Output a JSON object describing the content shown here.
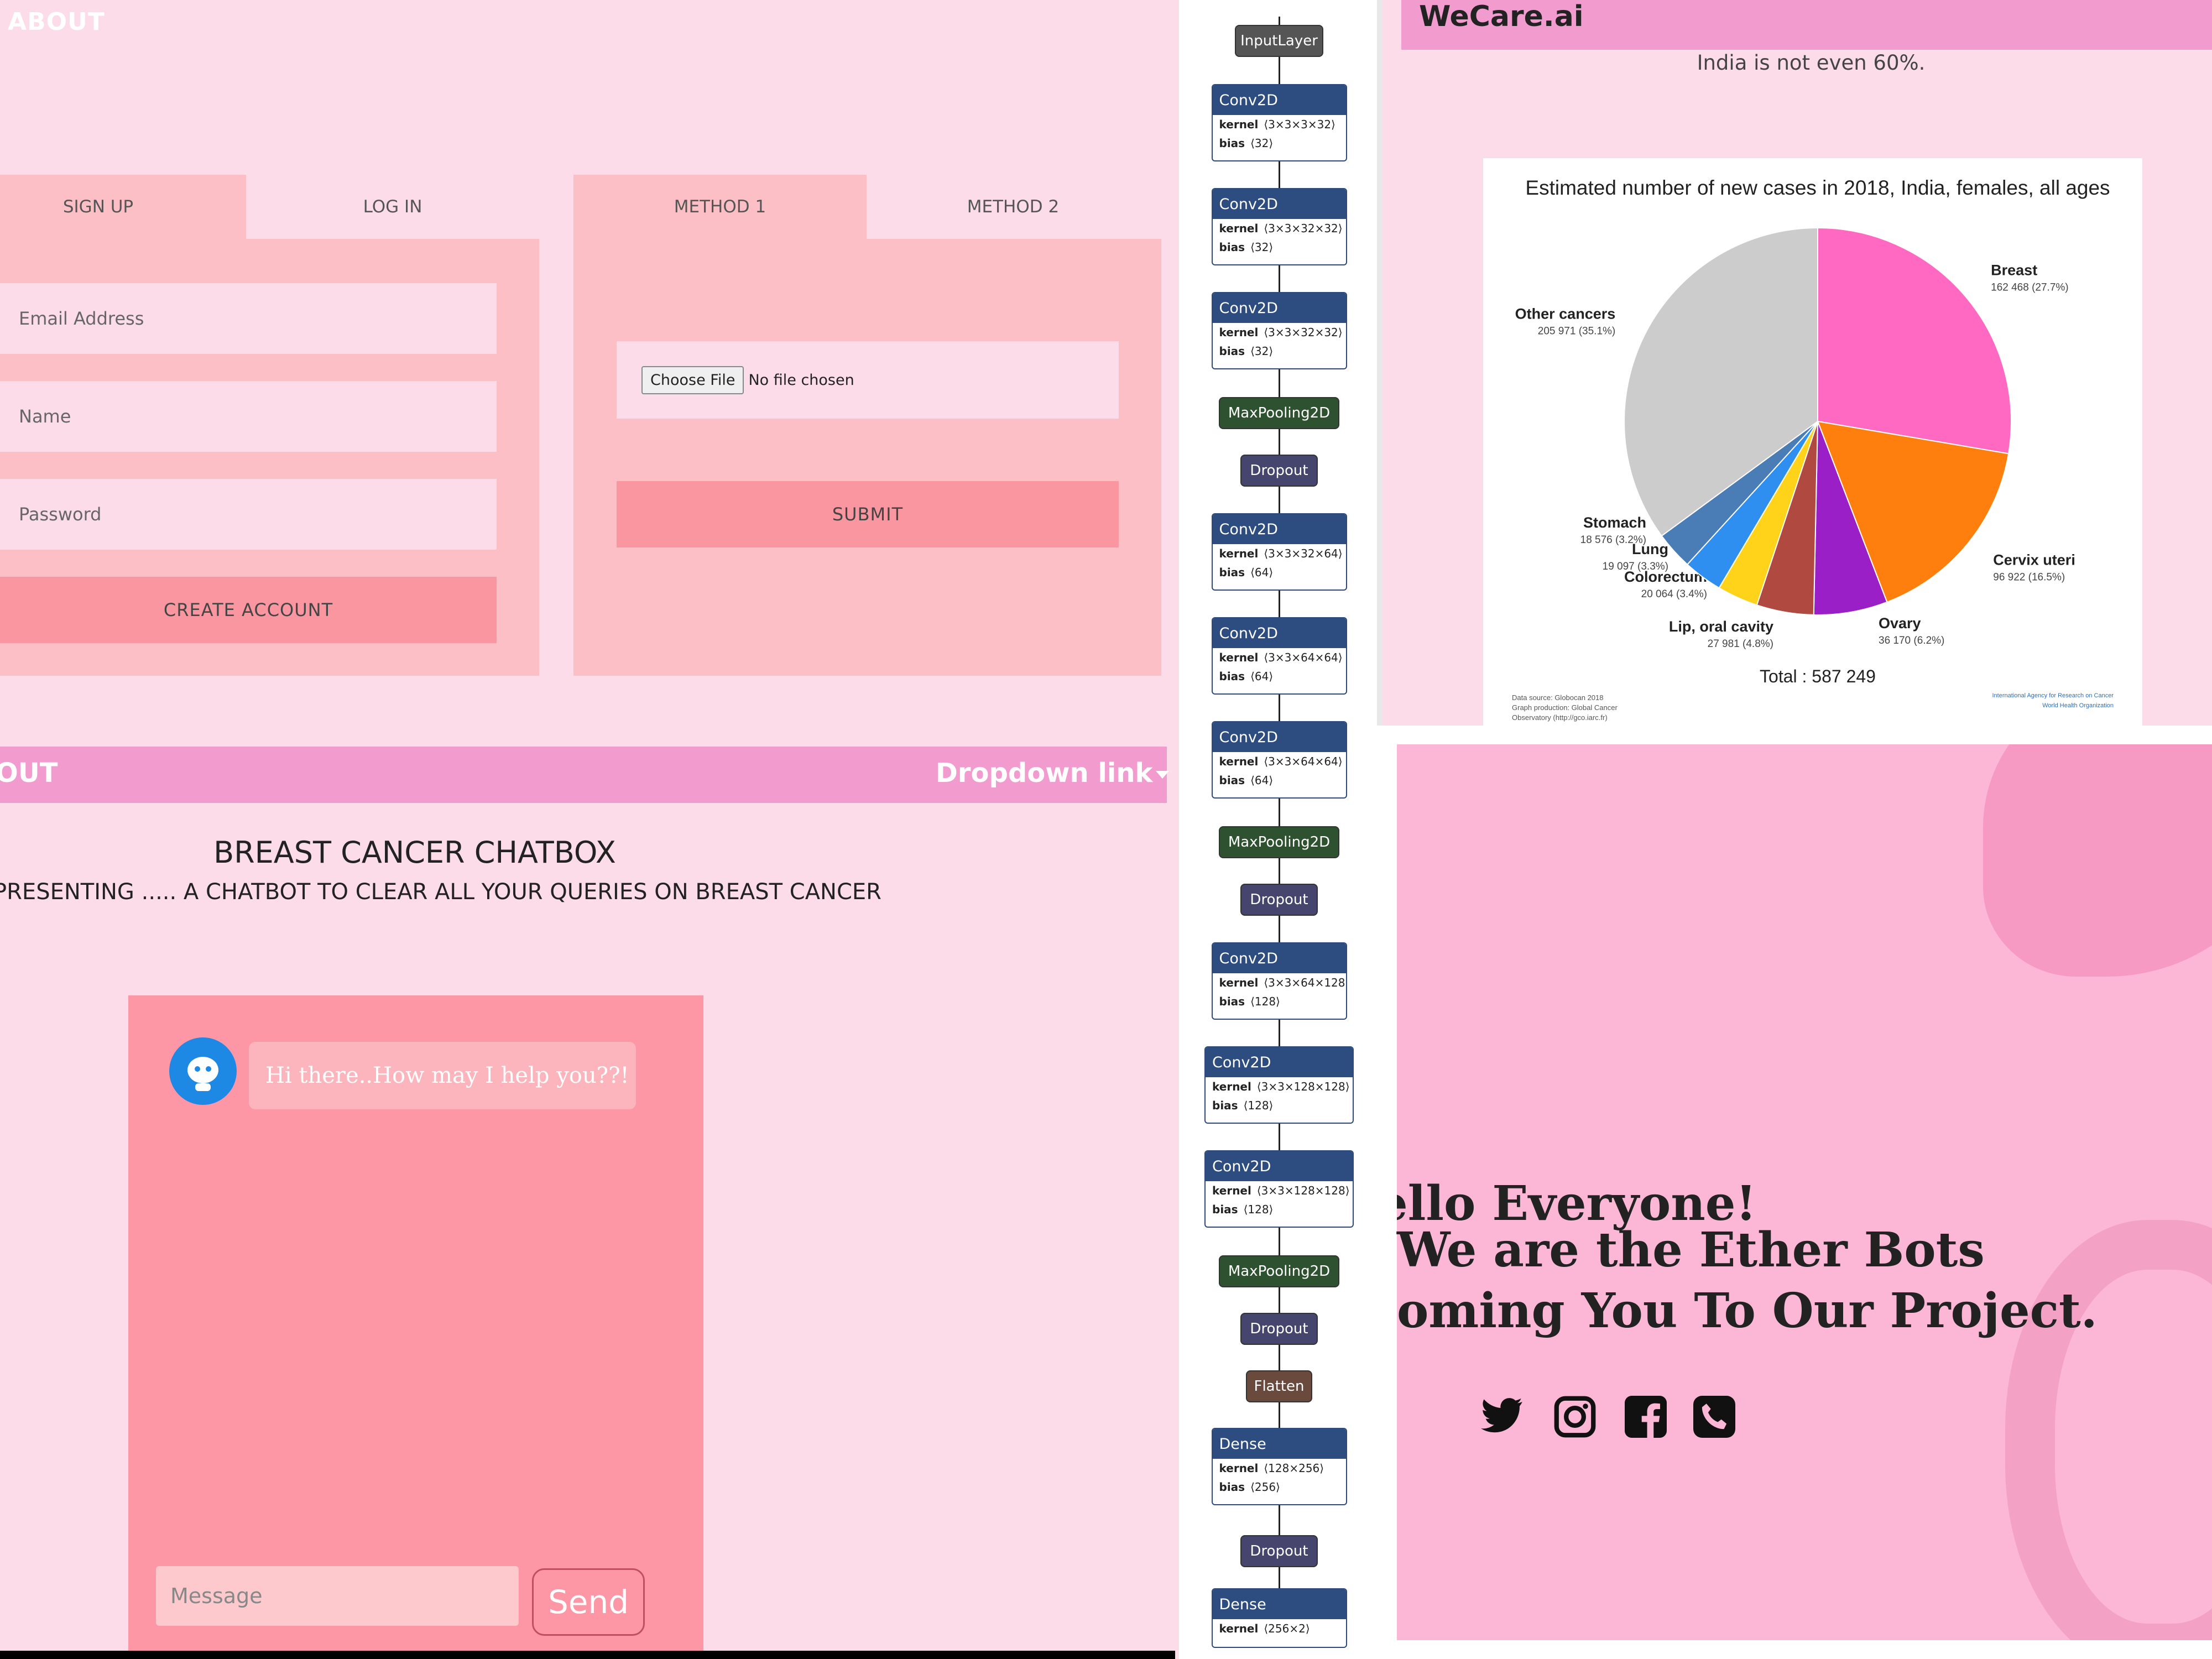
{
  "panel1": {
    "title": "ABOUT",
    "signup_tabs": [
      "SIGN UP",
      "LOG IN"
    ],
    "method_tabs": [
      "METHOD 1",
      "METHOD 2"
    ],
    "fields": {
      "email": "Email Address",
      "name": "Name",
      "password": "Password"
    },
    "create_account": "CREATE ACCOUNT",
    "choose_file": "Choose File",
    "no_file": "No file chosen",
    "submit": "SUBMIT"
  },
  "panel2": {
    "nav_left": "OUT",
    "nav_dropdown": "Dropdown link",
    "heading": "BREAST CANCER CHATBOX",
    "subheading": "PRESENTING ..... A CHATBOT TO CLEAR ALL YOUR QUERIES ON BREAST CANCER",
    "bot_message": "Hi there..How may I help you??!",
    "message_placeholder": "Message",
    "send": "Send"
  },
  "model": {
    "layers": [
      {
        "name": "InputLayer",
        "kind": "input"
      },
      {
        "name": "Conv2D",
        "kind": "labeled",
        "kernel": "⟨3×3×3×32⟩",
        "bias": "⟨32⟩"
      },
      {
        "name": "Conv2D",
        "kind": "labeled",
        "kernel": "⟨3×3×32×32⟩",
        "bias": "⟨32⟩"
      },
      {
        "name": "Conv2D",
        "kind": "labeled",
        "kernel": "⟨3×3×32×32⟩",
        "bias": "⟨32⟩"
      },
      {
        "name": "MaxPooling2D",
        "kind": "pool"
      },
      {
        "name": "Dropout",
        "kind": "dropout"
      },
      {
        "name": "Conv2D",
        "kind": "labeled",
        "kernel": "⟨3×3×32×64⟩",
        "bias": "⟨64⟩"
      },
      {
        "name": "Conv2D",
        "kind": "labeled",
        "kernel": "⟨3×3×64×64⟩",
        "bias": "⟨64⟩"
      },
      {
        "name": "Conv2D",
        "kind": "labeled",
        "kernel": "⟨3×3×64×64⟩",
        "bias": "⟨64⟩"
      },
      {
        "name": "MaxPooling2D",
        "kind": "pool"
      },
      {
        "name": "Dropout",
        "kind": "dropout"
      },
      {
        "name": "Conv2D",
        "kind": "labeled",
        "kernel": "⟨3×3×64×128⟩",
        "bias": "⟨128⟩"
      },
      {
        "name": "Conv2D",
        "kind": "labeled",
        "kernel": "⟨3×3×128×128⟩",
        "bias": "⟨128⟩"
      },
      {
        "name": "Conv2D",
        "kind": "labeled",
        "kernel": "⟨3×3×128×128⟩",
        "bias": "⟨128⟩"
      },
      {
        "name": "MaxPooling2D",
        "kind": "pool"
      },
      {
        "name": "Dropout",
        "kind": "dropout"
      },
      {
        "name": "Flatten",
        "kind": "flatten"
      },
      {
        "name": "Dense",
        "kind": "labeled",
        "kernel": "⟨128×256⟩",
        "bias": "⟨256⟩"
      },
      {
        "name": "Dropout",
        "kind": "dropout"
      },
      {
        "name": "Dense",
        "kind": "labeled",
        "kernel": "⟨256×2⟩",
        "bias": ""
      }
    ],
    "kernel_label": "kernel",
    "bias_label": "bias",
    "colors": {
      "input": "#555555",
      "labeled": "#2d4c80",
      "pool": "#2e5230",
      "dropout": "#45456e",
      "flatten": "#6b4a3e"
    }
  },
  "panel4": {
    "brand": "WeCare.ai",
    "note": "India is not even 60%.",
    "chart_data": {
      "type": "pie",
      "title": "Estimated number of new cases in 2018, India, females, all ages",
      "slices": [
        {
          "name": "Breast",
          "value": 162468,
          "label": "162 468 (27.7%)",
          "color": "#ff69c2"
        },
        {
          "name": "Cervix uteri",
          "value": 96922,
          "label": "96 922 (16.5%)",
          "color": "#ff7f0e"
        },
        {
          "name": "Ovary",
          "value": 36170,
          "label": "36 170 (6.2%)",
          "color": "#9b1fc7"
        },
        {
          "name": "Lip, oral cavity",
          "value": 27981,
          "label": "27 981 (4.8%)",
          "color": "#b04a40"
        },
        {
          "name": "Colorectum",
          "value": 20064,
          "label": "20 064 (3.4%)",
          "color": "#ffd31a"
        },
        {
          "name": "Lung",
          "value": 19097,
          "label": "19 097 (3.3%)",
          "color": "#2f8ff0"
        },
        {
          "name": "Stomach",
          "value": 18576,
          "label": "18 576 (3.2%)",
          "color": "#4a7db5"
        },
        {
          "name": "Other cancers",
          "value": 205971,
          "label": "205 971 (35.1%)",
          "color": "#cccccc"
        }
      ],
      "total_label": "Total : 587 249",
      "source_lines": [
        "Data source: Globocan 2018",
        "Graph production: Global Cancer",
        "Observatory (http://gco.iarc.fr)"
      ],
      "org_lines": [
        "International Agency for Research on Cancer",
        "World Health Organization"
      ]
    }
  },
  "panel5": {
    "line1": "Hello Everyone!",
    "line2": "We are the Ether Bots",
    "line3": "oming You To Our Project.",
    "icons": [
      "twitter-icon",
      "instagram-icon",
      "facebook-icon",
      "phone-icon"
    ]
  }
}
